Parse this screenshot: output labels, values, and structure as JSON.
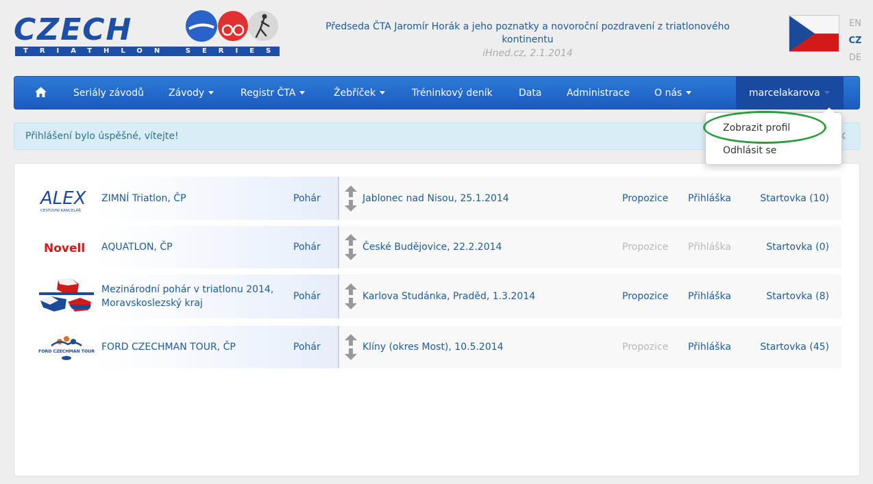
{
  "header": {
    "logo_text": "CZECH",
    "logo_subtitle": "TRIATHLON SERIES",
    "news_title": "Předseda ČTA Jaromír Horák a jeho poznatky a novoroční pozdravení z triatlonového kontinentu",
    "news_meta": "iHned.cz, 2.1.2014",
    "languages": [
      "EN",
      "CZ",
      "DE"
    ]
  },
  "nav": {
    "home_icon": "home-icon",
    "items": [
      "Seriály závodů",
      "Závody",
      "Registr ČTA",
      "Žebříček",
      "Tréninkový deník",
      "Data",
      "Administrace",
      "O nás"
    ],
    "user": "marcelakarova"
  },
  "dropdown": {
    "items": [
      "Zobrazit profil",
      "Odhlásit se"
    ]
  },
  "alert": {
    "text": "Přihlášení bylo úspěšné, vítejte!",
    "close": "×"
  },
  "races": [
    {
      "name": "ZIMNÍ Triatlon, ČP",
      "cup": "Pohár",
      "place": "Jablonec nad Nisou, 25.1.2014",
      "propozice": "Propozice",
      "prihlaska": "Přihláška",
      "startovka": "Startovka (10)",
      "sponsor": "ALEX",
      "sponsor_sub": "CESTOVNÍ KANCELÁŘ"
    },
    {
      "name": "AQUATLON, ČP",
      "cup": "Pohár",
      "place": "České Budějovice, 22.2.2014",
      "propozice": "Propozice",
      "prihlaska": "Přihláška",
      "startovka": "Startovka (0)",
      "sponsor": "Novell"
    },
    {
      "name": "Mezinárodní pohár v triatlonu 2014, Moravskoslezský kraj",
      "cup": "Pohár",
      "place": "Karlova Studánka, Praděd, 1.3.2014",
      "propozice": "Propozice",
      "prihlaska": "Přihláška",
      "startovka": "Startovka (8)"
    },
    {
      "name": "FORD CZECHMAN TOUR, ČP",
      "cup": "Pohár",
      "place": "Klíny (okres Most), 10.5.2014",
      "propozice": "Propozice",
      "prihlaska": "Přihláška",
      "startovka": "Startovka (45)",
      "sponsor": "FORD CZECHMAN TOUR"
    }
  ],
  "colors": {
    "nav_bg": "#2a72d0",
    "nav_active": "#1a4aa0",
    "link": "#1d5a9c",
    "disabled": "#b8b8b8",
    "alert_bg": "#d9edf7",
    "highlight": "#2a9c3a"
  }
}
